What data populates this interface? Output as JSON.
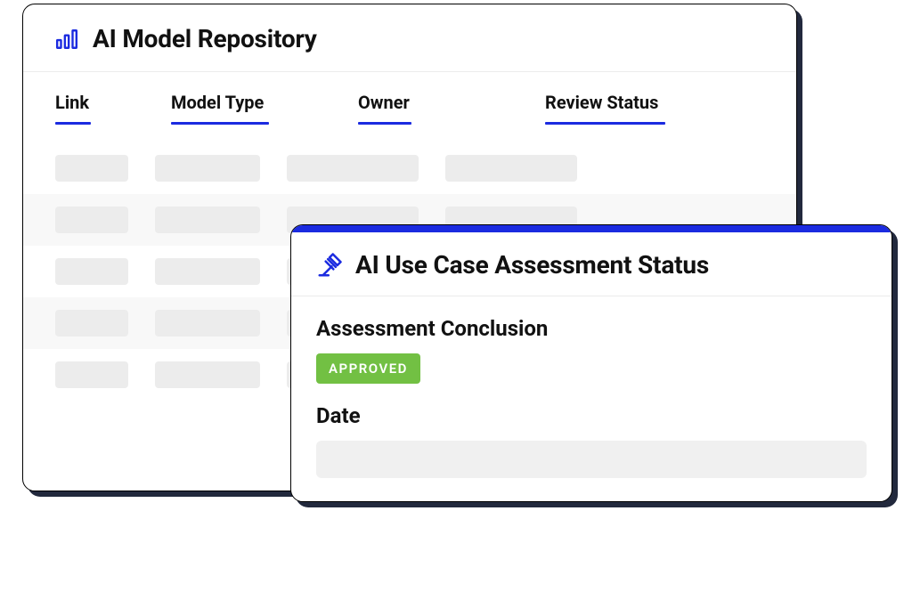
{
  "repository": {
    "title": "AI Model Repository",
    "icon": "bar-chart-icon",
    "columns": [
      {
        "key": "link",
        "label": "Link"
      },
      {
        "key": "model_type",
        "label": "Model Type"
      },
      {
        "key": "owner",
        "label": "Owner"
      },
      {
        "key": "review_status",
        "label": "Review Status"
      }
    ],
    "rows": [
      {
        "link": "",
        "model_type": "",
        "owner": "",
        "review_status": ""
      },
      {
        "link": "",
        "model_type": "",
        "owner": "",
        "review_status": ""
      },
      {
        "link": "",
        "model_type": "",
        "owner": "",
        "review_status": ""
      },
      {
        "link": "",
        "model_type": "",
        "owner": "",
        "review_status": ""
      },
      {
        "link": "",
        "model_type": "",
        "owner": "",
        "review_status": ""
      }
    ]
  },
  "assessment": {
    "title": "AI Use Case Assessment Status",
    "icon": "gavel-icon",
    "conclusion_label": "Assessment Conclusion",
    "conclusion_status": "APPROVED",
    "date_label": "Date",
    "date_value": ""
  },
  "colors": {
    "accent": "#1b2be0",
    "approved_badge": "#72c043"
  }
}
